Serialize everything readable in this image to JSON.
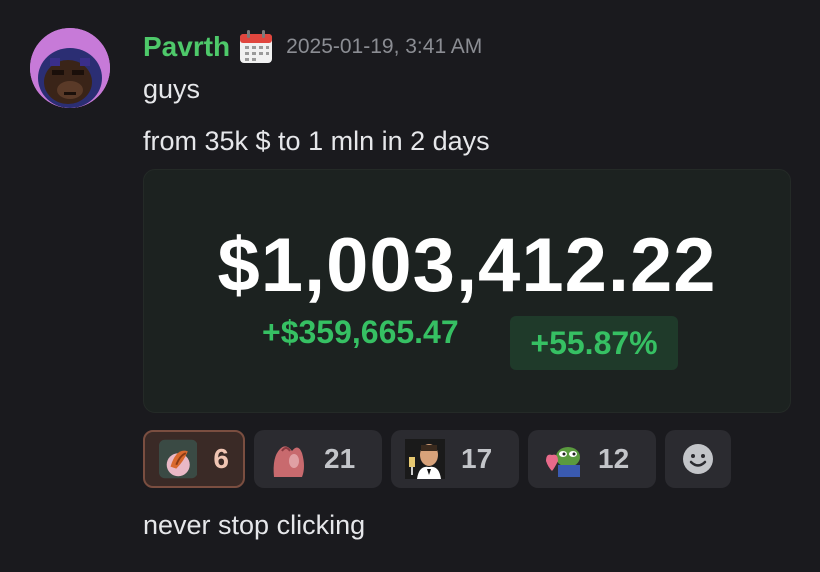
{
  "message": {
    "username": "Pavrth",
    "badge_icon": "calendar-icon",
    "timestamp": "2025-01-19, 3:41 AM",
    "lines": [
      "guys",
      "from 35k $ to 1 mln in 2 days",
      "never stop clicking"
    ]
  },
  "embed": {
    "amount": "$1,003,412.22",
    "change": "+$359,665.47",
    "percent": "+55.87%"
  },
  "reactions": [
    {
      "emoji": "cat-paw-emoji",
      "count": "6",
      "active": true
    },
    {
      "emoji": "pink-hand-emoji",
      "count": "21",
      "active": false
    },
    {
      "emoji": "laughing-man-toast-emoji",
      "count": "17",
      "active": false
    },
    {
      "emoji": "pepe-hug-emoji",
      "count": "12",
      "active": false
    }
  ],
  "add_reaction_icon": "smiley-add-reaction-icon",
  "colors": {
    "background": "#1a1a1e",
    "username": "#4ec96a",
    "gain_green": "#36c063",
    "avatar_ring": "#c77ad8"
  }
}
